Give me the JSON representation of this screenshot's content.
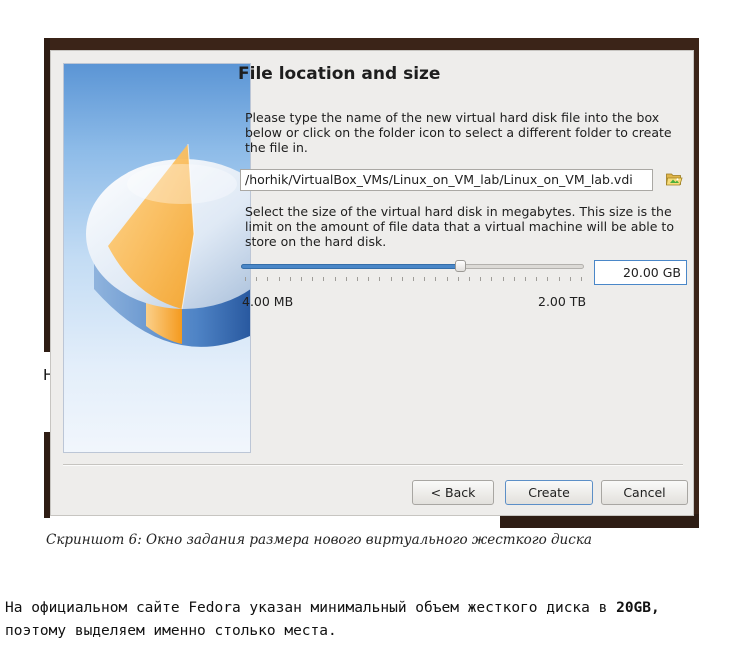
{
  "dialog": {
    "title": "File location and size",
    "location_instructions": "Please type the name of the new virtual hard disk file into the box below or click on the folder icon to select a different folder to create the file in.",
    "file_path": "/horhik/VirtualBox_VMs/Linux_on_VM_lab/Linux_on_VM_lab.vdi",
    "folder_icon": "folder-open-icon",
    "size_instructions": "Select the size of the virtual hard disk in megabytes. This size is the limit on the amount of file data that a virtual machine will be able to store on the hard disk.",
    "size_value": "20.00 GB",
    "slider_fraction": 0.64,
    "range_min": "4.00 MB",
    "range_max": "2.00 TB",
    "buttons": {
      "back": "< Back",
      "create": "Create",
      "cancel": "Cancel"
    },
    "accent_color": "#4a87c8"
  },
  "page": {
    "stray_glyph": "Н",
    "caption": "Скриншот 6: Окно задания размера нового виртуального жесткого диска",
    "paragraph_part1": "На официальном сайте Fedora указан минимальный объем жесткого диска в ",
    "paragraph_bold": "20GB,",
    "paragraph_part2": " поэтому выделяем именно столько места."
  }
}
